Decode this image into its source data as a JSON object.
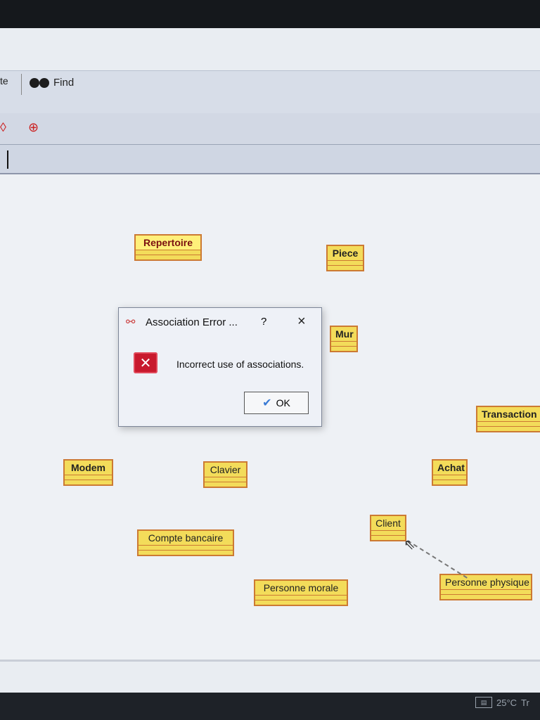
{
  "toolbar": {
    "left_fragment": "te",
    "find_label": "Find"
  },
  "classes": [
    {
      "id": "repertoire",
      "label": "Repertoire"
    },
    {
      "id": "piece",
      "label": "Piece"
    },
    {
      "id": "mur",
      "label": "Mur"
    },
    {
      "id": "transaction",
      "label": "Transaction b"
    },
    {
      "id": "modem",
      "label": "Modem"
    },
    {
      "id": "clavier",
      "label": "Clavier"
    },
    {
      "id": "achat",
      "label": "Achat"
    },
    {
      "id": "client",
      "label": "Client"
    },
    {
      "id": "compte",
      "label": "Compte bancaire"
    },
    {
      "id": "personne_morale",
      "label": "Personne morale"
    },
    {
      "id": "personne_physique",
      "label": "Personne physique"
    }
  ],
  "dialog": {
    "title": "Association Error ...",
    "help": "?",
    "close": "×",
    "message": "Incorrect use of associations.",
    "ok_label": "OK"
  },
  "taskbar": {
    "weather": "25°C",
    "weather_extra": "Tr"
  }
}
